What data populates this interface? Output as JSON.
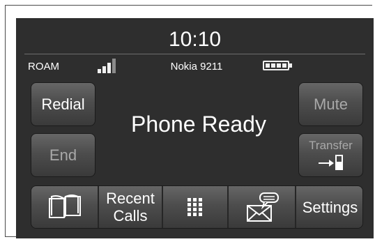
{
  "header": {
    "time": "10:10",
    "roam_label": "ROAM",
    "device_name": "Nokia 9211",
    "signal_bars_active": 3,
    "signal_bars_total": 4,
    "battery_level": 1.0
  },
  "main": {
    "status_text": "Phone Ready"
  },
  "buttons": {
    "redial": "Redial",
    "end": "End",
    "mute": "Mute",
    "transfer": "Transfer",
    "transfer_icon": "transfer-to-handset-icon"
  },
  "bottom_bar": {
    "phonebook_icon": "phonebook-icon",
    "recent_calls_line1": "Recent",
    "recent_calls_line2": "Calls",
    "keypad_icon": "keypad-icon",
    "messages_icon": "messages-icon",
    "settings": "Settings"
  },
  "colors": {
    "screen_bg": "#2e2e2e",
    "button_active_text": "#ffffff",
    "button_inactive_text": "#a9a9a9"
  }
}
